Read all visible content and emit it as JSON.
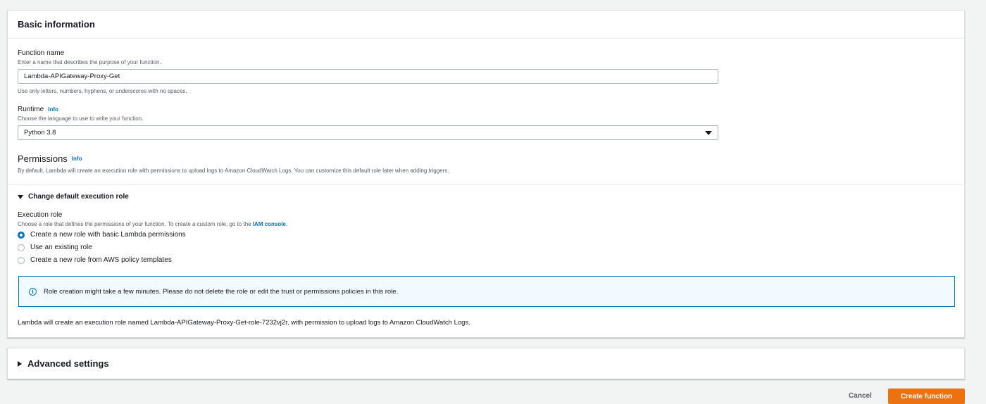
{
  "basic": {
    "header": "Basic information",
    "function_name": {
      "label": "Function name",
      "description": "Enter a name that describes the purpose of your function.",
      "value": "Lambda-APIGateway-Proxy-Get",
      "constraint": "Use only letters, numbers, hyphens, or underscores with no spaces."
    },
    "runtime": {
      "label": "Runtime",
      "info": "Info",
      "description": "Choose the language to use to write your function.",
      "selected": "Python 3.8"
    },
    "permissions": {
      "title": "Permissions",
      "info": "Info",
      "description": "By default, Lambda will create an execution role with permissions to upload logs to Amazon CloudWatch Logs. You can customize this default role later when adding triggers."
    },
    "execution_role_toggle": "Change default execution role",
    "execution_role": {
      "label": "Execution role",
      "description_prefix": "Choose a role that defines the permissions of your function. To create a custom role, go to the ",
      "description_link": "IAM console",
      "description_suffix": ".",
      "options": [
        {
          "label": "Create a new role with basic Lambda permissions",
          "checked": true
        },
        {
          "label": "Use an existing role",
          "checked": false
        },
        {
          "label": "Create a new role from AWS policy templates",
          "checked": false
        }
      ]
    },
    "alert": "Role creation might take a few minutes. Please do not delete the role or edit the trust or permissions policies in this role.",
    "footer_note": "Lambda will create an execution role named Lambda-APIGateway-Proxy-Get-role-7232vj2r, with permission to upload logs to Amazon CloudWatch Logs."
  },
  "advanced": {
    "header": "Advanced settings"
  },
  "actions": {
    "cancel": "Cancel",
    "create": "Create function"
  },
  "colors": {
    "primary": "#ec7211",
    "link": "#0073bb",
    "background": "#f2f3f3"
  }
}
